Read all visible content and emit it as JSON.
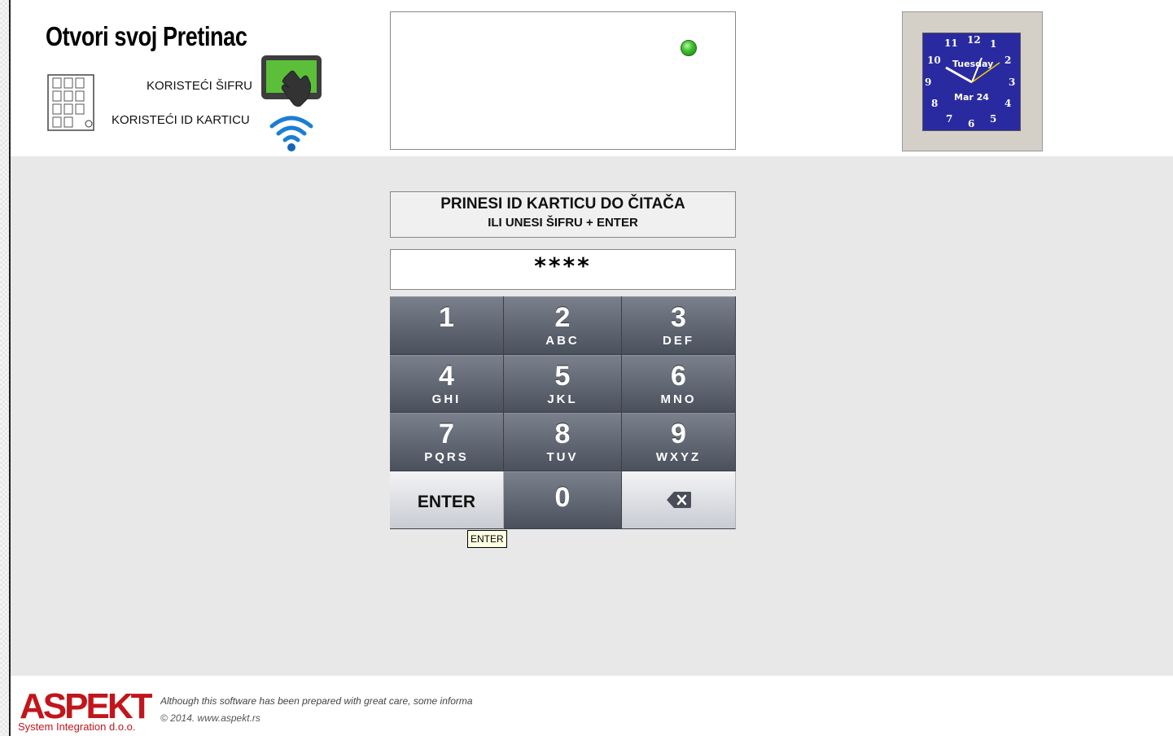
{
  "header": {
    "title": "Otvori svoj Pretinac",
    "option_code_label": "KORISTEĆI ŠIFRU",
    "option_card_label": "KORISTEĆI ID KARTICU"
  },
  "clock": {
    "numbers": [
      "12",
      "1",
      "2",
      "3",
      "4",
      "5",
      "6",
      "7",
      "8",
      "9",
      "10",
      "11"
    ],
    "day": "Tuesday",
    "date": "Mar 24"
  },
  "prompt": {
    "line1": "PRINESI ID KARTICU DO ČITAČA",
    "line2": "ILI UNESI ŠIFRU + ENTER"
  },
  "pin": {
    "value": "****"
  },
  "keypad": {
    "keys": [
      {
        "digit": "1",
        "letters": ""
      },
      {
        "digit": "2",
        "letters": "ABC"
      },
      {
        "digit": "3",
        "letters": "DEF"
      },
      {
        "digit": "4",
        "letters": "GHI"
      },
      {
        "digit": "5",
        "letters": "JKL"
      },
      {
        "digit": "6",
        "letters": "MNO"
      },
      {
        "digit": "7",
        "letters": "PQRS"
      },
      {
        "digit": "8",
        "letters": "TUV"
      },
      {
        "digit": "9",
        "letters": "WXYZ"
      }
    ],
    "enter_label": "ENTER",
    "zero": "0"
  },
  "tooltip": {
    "text": "ENTER"
  },
  "footer": {
    "logo_text": "ASPEKT",
    "logo_subtitle": "System Integration d.o.o.",
    "note": "Although this software has been prepared with great care, some informa",
    "copyright": "© 2014. www.aspekt.rs"
  },
  "colors": {
    "keypad_dark": "#4a505c",
    "status_led": "#3fc22e",
    "clock_face": "#2a2aa0",
    "brand_red": "#c0161c"
  }
}
